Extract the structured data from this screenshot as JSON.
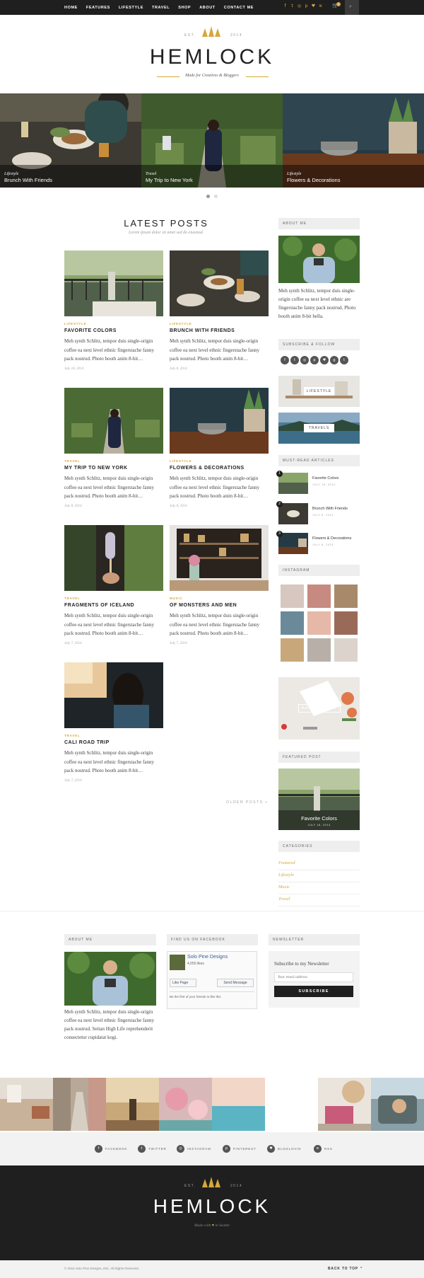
{
  "nav": {
    "menu": [
      "HOME",
      "FEATURES",
      "LIFESTYLE",
      "TRAVEL",
      "SHOP",
      "ABOUT",
      "CONTACT ME"
    ],
    "social_icons": [
      "facebook-icon",
      "twitter-icon",
      "instagram-icon",
      "pinterest-icon",
      "heart-icon",
      "rss-icon"
    ],
    "cart_count": "0"
  },
  "brand": {
    "est": "EST.",
    "year": "2014",
    "title": "HEMLOCK",
    "tagline": "Made for Creatives & Bloggers",
    "accent": "#d6a73b"
  },
  "slider": [
    {
      "category": "Lifestyle",
      "title": "Brunch With Friends"
    },
    {
      "category": "Travel",
      "title": "My Trip to New York"
    },
    {
      "category": "Lifestyle",
      "title": "Flowers & Decorations"
    }
  ],
  "latest": {
    "title": "LATEST POSTS",
    "subtitle": "Lorem ipsum dolor sit amet sed do eiusmod."
  },
  "posts": [
    {
      "category": "LIFESTYLE",
      "title": "FAVORITE COLORS",
      "excerpt": "Meh synth Schlitz, tempor duis single-origin coffee ea next level ethnic fingerstache fanny pack nostrud. Photo booth anim 8-bit…",
      "date": "July 18, 2014"
    },
    {
      "category": "LIFESTYLE",
      "title": "BRUNCH WITH FRIENDS",
      "excerpt": "Meh synth Schlitz, tempor duis single-origin coffee ea next level ethnic fingerstache fanny pack nostrud. Photo booth anim 8-bit…",
      "date": "July 8, 2014"
    },
    {
      "category": "TRAVEL",
      "title": "MY TRIP TO NEW YORK",
      "excerpt": "Meh synth Schlitz, tempor duis single-origin coffee ea next level ethnic fingerstache fanny pack nostrud. Photo booth anim 8-bit…",
      "date": "July 8, 2014"
    },
    {
      "category": "LIFESTYLE",
      "title": "FLOWERS & DECORATIONS",
      "excerpt": "Meh synth Schlitz, tempor duis single-origin coffee ea next level ethnic fingerstache fanny pack nostrud. Photo booth anim 8-bit…",
      "date": "July 8, 2014"
    },
    {
      "category": "TRAVEL",
      "title": "FRAGMENTS OF ICELAND",
      "excerpt": "Meh synth Schlitz, tempor duis single-origin coffee ea next level ethnic fingerstache fanny pack nostrud. Photo booth anim 8-bit…",
      "date": "July 7, 2014"
    },
    {
      "category": "MUSIC",
      "title": "OF MONSTERS AND MEN",
      "excerpt": "Meh synth Schlitz, tempor duis single-origin coffee ea next level ethnic fingerstache fanny pack nostrud. Photo booth anim 8-bit…",
      "date": "July 7, 2014"
    },
    {
      "category": "TRAVEL",
      "title": "CALI ROAD TRIP",
      "excerpt": "Meh synth Schlitz, tempor duis single-origin coffee ea next level ethnic fingerstache fanny pack nostrud. Photo booth anim 8-bit…",
      "date": "July 7, 2014"
    }
  ],
  "older_posts": "OLDER POSTS »",
  "sidebar": {
    "about_title": "ABOUT ME",
    "about_text": "Meh synth Schlitz, tempor duis single-origin coffee ea next level ethnic are fingerstache fanny pack nostrud. Photo booth anim 8-bit hella.",
    "subscribe_title": "SUBSCRIBE & FOLLOW",
    "subscribe_icons": [
      "facebook-icon",
      "twitter-icon",
      "instagram-icon",
      "pinterest-icon",
      "heart-icon",
      "google-plus-icon",
      "tumblr-icon"
    ],
    "banners": [
      "LIFESTYLE",
      "TRAVELS"
    ],
    "must_read_title": "MUST-READ ARTICLES",
    "must_read": [
      {
        "num": "1",
        "title": "Favorite Colors",
        "date": "JULY 18, 2014"
      },
      {
        "num": "2",
        "title": "Brunch With Friends",
        "date": "JULY 8, 2014"
      },
      {
        "num": "3",
        "title": "Flowers & Decorations",
        "date": "JULY 8, 2014"
      }
    ],
    "instagram_title": "INSTAGRAM",
    "promo": "BANNER SPOT",
    "featured_title": "FEATURED POST",
    "featured_post": {
      "title": "Favorite Colors",
      "date": "JULY 18, 2014"
    },
    "categories_title": "CATEGORIES",
    "categories": [
      "Featured",
      "Lifestyle",
      "Music",
      "Travel"
    ]
  },
  "footer_widgets": {
    "about_title": "ABOUT ME",
    "about_text": "Meh synth Schlitz, tempor duis single-origin coffee ea next level ethnic fingerstache fanny pack nostrud. Seitan High Life reprehenderit consectetur cupidatat kogi.",
    "fb_title": "FIND US ON FACEBOOK",
    "fb_page": "Solo Pine Designs",
    "fb_likes": "4,050 likes",
    "fb_like": "Like Page",
    "fb_message": "Send Message",
    "fb_friends": "Be the first of your friends to like this",
    "newsletter_title": "NEWSLETTER",
    "newsletter_heading": "Subscribe to my Newsletter",
    "email_placeholder": "Your email address",
    "subscribe_button": "SUBSCRIBE"
  },
  "social_bar": [
    "FACEBOOK",
    "TWITTER",
    "INSTAGRAM",
    "PINTEREST",
    "BLOGLOVIN",
    "RSS"
  ],
  "footer": {
    "est": "EST.",
    "year": "2014",
    "title": "HEMLOCK",
    "made_with": "Made with",
    "in_city": "in Seattle",
    "copyright": "© 2015 Solo Pine Designs, INC. All Rights Reserved.",
    "back_to_top": "BACK TO TOP ⌃"
  }
}
